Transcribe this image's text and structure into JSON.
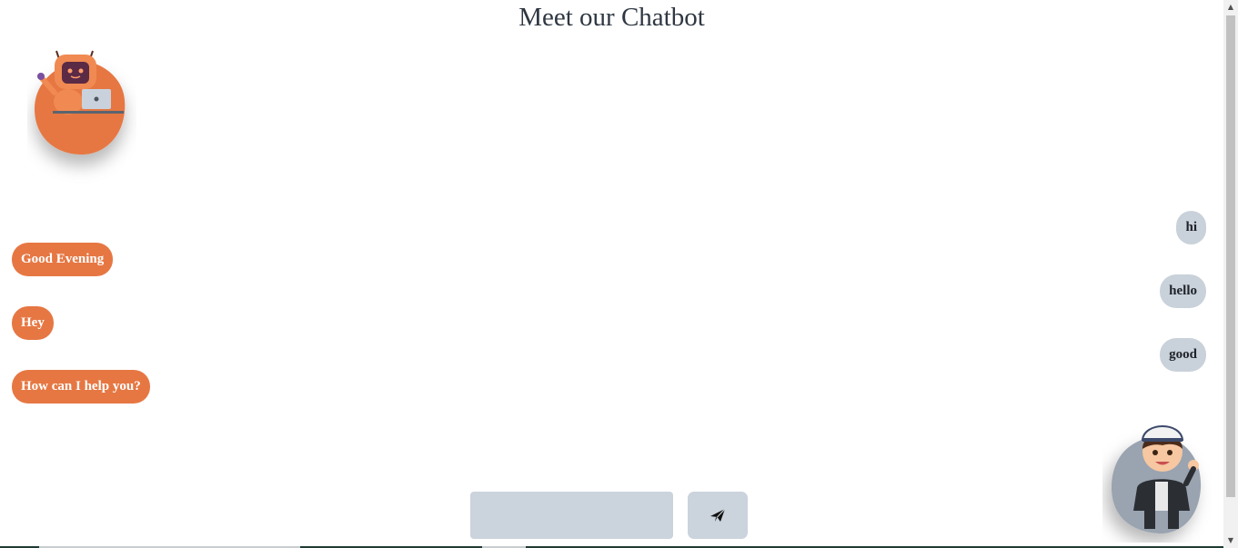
{
  "header": {
    "title": "Meet our Chatbot"
  },
  "avatars": {
    "bot": "robot-avatar",
    "user": "boy-avatar"
  },
  "messages": {
    "bot": [
      {
        "text": "Good Evening"
      },
      {
        "text": "Hey"
      },
      {
        "text": "How can I help you?"
      }
    ],
    "user": [
      {
        "text": "hi"
      },
      {
        "text": "hello"
      },
      {
        "text": "good"
      }
    ]
  },
  "composer": {
    "input_value": "",
    "send_icon": "send-icon"
  },
  "colors": {
    "bot_bubble": "#e67743",
    "user_bubble": "#c9d1da",
    "input_bg": "#cbd3dc",
    "title": "#2f3742"
  }
}
